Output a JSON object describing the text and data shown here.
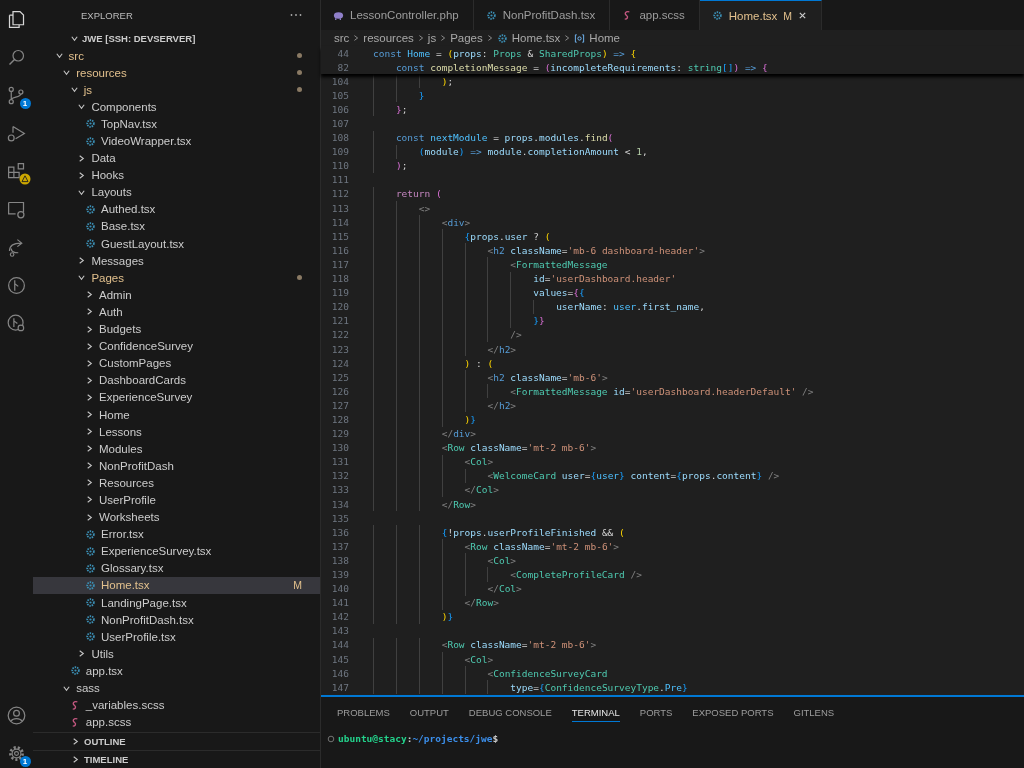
{
  "activity_bar": {
    "top": [
      {
        "kind": "explorer",
        "selected": true
      },
      {
        "kind": "search",
        "selected": false
      },
      {
        "kind": "scm",
        "selected": false,
        "badge": "1"
      },
      {
        "kind": "debug",
        "selected": false
      },
      {
        "kind": "extensions",
        "selected": false,
        "warning": true
      },
      {
        "kind": "remote",
        "selected": false
      },
      {
        "kind": "share",
        "selected": false
      },
      {
        "kind": "graph",
        "selected": false
      },
      {
        "kind": "history",
        "selected": false
      }
    ],
    "bottom": [
      {
        "kind": "account",
        "selected": false
      },
      {
        "kind": "settings",
        "selected": false,
        "badge": "1"
      }
    ]
  },
  "explorer": {
    "title": "EXPLORER",
    "project": {
      "label": "JWE [SSH: DEVSERVER]",
      "expanded": true
    },
    "tree": [
      {
        "label": "src",
        "kind": "folder",
        "expanded": true,
        "modified": true,
        "selected": false,
        "children": [
          {
            "label": "resources",
            "kind": "folder",
            "expanded": true,
            "modified": true,
            "selected": false,
            "children": [
              {
                "label": "js",
                "kind": "folder",
                "expanded": true,
                "modified": true,
                "selected": false,
                "children": [
                  {
                    "label": "Components",
                    "kind": "folder",
                    "expanded": true,
                    "modified": false,
                    "selected": false,
                    "children": [
                      {
                        "label": "TopNav.tsx",
                        "kind": "react",
                        "modified": false,
                        "selected": false
                      },
                      {
                        "label": "VideoWrapper.tsx",
                        "kind": "react",
                        "modified": false,
                        "selected": false
                      }
                    ]
                  },
                  {
                    "label": "Data",
                    "kind": "folder",
                    "expanded": false,
                    "modified": false,
                    "selected": false
                  },
                  {
                    "label": "Hooks",
                    "kind": "folder",
                    "expanded": false,
                    "modified": false,
                    "selected": false
                  },
                  {
                    "label": "Layouts",
                    "kind": "folder",
                    "expanded": true,
                    "modified": false,
                    "selected": false,
                    "children": [
                      {
                        "label": "Authed.tsx",
                        "kind": "react",
                        "modified": false,
                        "selected": false
                      },
                      {
                        "label": "Base.tsx",
                        "kind": "react",
                        "modified": false,
                        "selected": false
                      },
                      {
                        "label": "GuestLayout.tsx",
                        "kind": "react",
                        "modified": false,
                        "selected": false
                      }
                    ]
                  },
                  {
                    "label": "Messages",
                    "kind": "folder",
                    "expanded": false,
                    "modified": false,
                    "selected": false
                  },
                  {
                    "label": "Pages",
                    "kind": "folder",
                    "expanded": true,
                    "modified": true,
                    "selected": false,
                    "children": [
                      {
                        "label": "Admin",
                        "kind": "folder",
                        "expanded": false,
                        "modified": false,
                        "selected": false
                      },
                      {
                        "label": "Auth",
                        "kind": "folder",
                        "expanded": false,
                        "modified": false,
                        "selected": false
                      },
                      {
                        "label": "Budgets",
                        "kind": "folder",
                        "expanded": false,
                        "modified": false,
                        "selected": false
                      },
                      {
                        "label": "ConfidenceSurvey",
                        "kind": "folder",
                        "expanded": false,
                        "modified": false,
                        "selected": false
                      },
                      {
                        "label": "CustomPages",
                        "kind": "folder",
                        "expanded": false,
                        "modified": false,
                        "selected": false
                      },
                      {
                        "label": "DashboardCards",
                        "kind": "folder",
                        "expanded": false,
                        "modified": false,
                        "selected": false
                      },
                      {
                        "label": "ExperienceSurvey",
                        "kind": "folder",
                        "expanded": false,
                        "modified": false,
                        "selected": false
                      },
                      {
                        "label": "Home",
                        "kind": "folder",
                        "expanded": false,
                        "modified": false,
                        "selected": false
                      },
                      {
                        "label": "Lessons",
                        "kind": "folder",
                        "expanded": false,
                        "modified": false,
                        "selected": false
                      },
                      {
                        "label": "Modules",
                        "kind": "folder",
                        "expanded": false,
                        "modified": false,
                        "selected": false
                      },
                      {
                        "label": "NonProfitDash",
                        "kind": "folder",
                        "expanded": false,
                        "modified": false,
                        "selected": false
                      },
                      {
                        "label": "Resources",
                        "kind": "folder",
                        "expanded": false,
                        "modified": false,
                        "selected": false
                      },
                      {
                        "label": "UserProfile",
                        "kind": "folder",
                        "expanded": false,
                        "modified": false,
                        "selected": false
                      },
                      {
                        "label": "Worksheets",
                        "kind": "folder",
                        "expanded": false,
                        "modified": false,
                        "selected": false
                      },
                      {
                        "label": "Error.tsx",
                        "kind": "react",
                        "modified": false,
                        "selected": false
                      },
                      {
                        "label": "ExperienceSurvey.tsx",
                        "kind": "react",
                        "modified": false,
                        "selected": false
                      },
                      {
                        "label": "Glossary.tsx",
                        "kind": "react",
                        "modified": false,
                        "selected": false
                      },
                      {
                        "label": "Home.tsx",
                        "kind": "react",
                        "modified": true,
                        "selected": true,
                        "badge": "M"
                      },
                      {
                        "label": "LandingPage.tsx",
                        "kind": "react",
                        "modified": false,
                        "selected": false
                      },
                      {
                        "label": "NonProfitDash.tsx",
                        "kind": "react",
                        "modified": false,
                        "selected": false
                      },
                      {
                        "label": "UserProfile.tsx",
                        "kind": "react",
                        "modified": false,
                        "selected": false
                      }
                    ]
                  },
                  {
                    "label": "Utils",
                    "kind": "folder",
                    "expanded": false,
                    "modified": false,
                    "selected": false
                  }
                ]
              },
              {
                "label": "app.tsx",
                "kind": "react",
                "modified": false,
                "selected": false
              }
            ]
          },
          {
            "label": "sass",
            "kind": "folder",
            "expanded": true,
            "modified": false,
            "selected": false,
            "children": [
              {
                "label": "_variables.scss",
                "kind": "sass",
                "modified": false,
                "selected": false
              },
              {
                "label": "app.scss",
                "kind": "sass",
                "modified": false,
                "selected": false
              }
            ]
          }
        ]
      }
    ],
    "sections": [
      {
        "label": "OUTLINE",
        "expanded": false
      },
      {
        "label": "TIMELINE",
        "expanded": false
      }
    ]
  },
  "editor": {
    "tabs": [
      {
        "label": "LessonController.php",
        "kind": "php",
        "selected": false,
        "modified": false
      },
      {
        "label": "NonProfitDash.tsx",
        "kind": "react",
        "selected": false,
        "modified": false
      },
      {
        "label": "app.scss",
        "kind": "sass",
        "selected": false,
        "modified": false
      },
      {
        "label": "Home.tsx",
        "kind": "react",
        "selected": true,
        "modified": true,
        "badge": "M"
      }
    ],
    "breadcrumbs": [
      {
        "label": "src",
        "kind": "folder"
      },
      {
        "label": "resources",
        "kind": "folder"
      },
      {
        "label": "js",
        "kind": "folder"
      },
      {
        "label": "Pages",
        "kind": "folder"
      },
      {
        "label": "Home.tsx",
        "kind": "react"
      },
      {
        "label": "Home",
        "kind": "symbol"
      }
    ],
    "sticky_lines": [
      {
        "number": "44",
        "tokens": [
          {
            "text": "const ",
            "kind": "keyword"
          },
          {
            "text": "Home",
            "kind": "constant"
          },
          {
            "text": " = ",
            "kind": "plain"
          },
          {
            "text": "(",
            "kind": "bracket1"
          },
          {
            "text": "props",
            "kind": "variable"
          },
          {
            "text": ": ",
            "kind": "plain"
          },
          {
            "text": "Props",
            "kind": "type"
          },
          {
            "text": " & ",
            "kind": "plain"
          },
          {
            "text": "SharedProps",
            "kind": "type"
          },
          {
            "text": ")",
            "kind": "bracket1"
          },
          {
            "text": " => ",
            "kind": "keyword"
          },
          {
            "text": "{",
            "kind": "bracket1"
          }
        ]
      },
      {
        "number": "82",
        "tokens": [
          {
            "text": "    const ",
            "kind": "keyword"
          },
          {
            "text": "completionMessage",
            "kind": "function"
          },
          {
            "text": " = ",
            "kind": "plain"
          },
          {
            "text": "(",
            "kind": "bracket2"
          },
          {
            "text": "incompleteRequirements",
            "kind": "variable"
          },
          {
            "text": ": ",
            "kind": "plain"
          },
          {
            "text": "string",
            "kind": "type"
          },
          {
            "text": "[]",
            "kind": "bracket3"
          },
          {
            "text": ")",
            "kind": "bracket2"
          },
          {
            "text": " => ",
            "kind": "keyword"
          },
          {
            "text": "{",
            "kind": "bracket2"
          }
        ]
      }
    ],
    "lines": [
      {
        "number": "104",
        "tokens": [
          {
            "text": "            )",
            "kind": "bracket1"
          },
          {
            "text": ";",
            "kind": "plain"
          }
        ]
      },
      {
        "number": "105",
        "tokens": [
          {
            "text": "        }",
            "kind": "bracket3"
          }
        ]
      },
      {
        "number": "106",
        "tokens": [
          {
            "text": "    }",
            "kind": "bracket2"
          },
          {
            "text": ";",
            "kind": "plain"
          }
        ]
      },
      {
        "number": "107"
      },
      {
        "number": "108",
        "tokens": [
          {
            "text": "    const ",
            "kind": "keyword"
          },
          {
            "text": "nextModule",
            "kind": "constant"
          },
          {
            "text": " = ",
            "kind": "plain"
          },
          {
            "text": "props",
            "kind": "variable"
          },
          {
            "text": ".",
            "kind": "plain"
          },
          {
            "text": "modules",
            "kind": "variable"
          },
          {
            "text": ".",
            "kind": "plain"
          },
          {
            "text": "find",
            "kind": "function"
          },
          {
            "text": "(",
            "kind": "bracket2"
          }
        ]
      },
      {
        "number": "109",
        "tokens": [
          {
            "text": "        (",
            "kind": "bracket3"
          },
          {
            "text": "module",
            "kind": "variable"
          },
          {
            "text": ")",
            "kind": "bracket3"
          },
          {
            "text": " => ",
            "kind": "keyword"
          },
          {
            "text": "module",
            "kind": "variable"
          },
          {
            "text": ".",
            "kind": "plain"
          },
          {
            "text": "completionAmount",
            "kind": "variable"
          },
          {
            "text": " < ",
            "kind": "plain"
          },
          {
            "text": "1",
            "kind": "number"
          },
          {
            "text": ",",
            "kind": "plain"
          }
        ]
      },
      {
        "number": "110",
        "tokens": [
          {
            "text": "    )",
            "kind": "bracket2"
          },
          {
            "text": ";",
            "kind": "plain"
          }
        ]
      },
      {
        "number": "111"
      },
      {
        "number": "112",
        "tokens": [
          {
            "text": "    return ",
            "kind": "control"
          },
          {
            "text": "(",
            "kind": "bracket2"
          }
        ]
      },
      {
        "number": "113",
        "tokens": [
          {
            "text": "        <>",
            "kind": "tag"
          }
        ]
      },
      {
        "number": "114",
        "tokens": [
          {
            "text": "            <",
            "kind": "tag"
          },
          {
            "text": "div",
            "kind": "html"
          },
          {
            "text": ">",
            "kind": "tag"
          }
        ]
      },
      {
        "number": "115",
        "tokens": [
          {
            "text": "                {",
            "kind": "bracket3"
          },
          {
            "text": "props",
            "kind": "variable"
          },
          {
            "text": ".",
            "kind": "plain"
          },
          {
            "text": "user",
            "kind": "variable"
          },
          {
            "text": " ? ",
            "kind": "plain"
          },
          {
            "text": "(",
            "kind": "bracket1"
          }
        ]
      },
      {
        "number": "116",
        "tokens": [
          {
            "text": "                    <",
            "kind": "tag"
          },
          {
            "text": "h2",
            "kind": "html"
          },
          {
            "text": " className",
            "kind": "variable"
          },
          {
            "text": "=",
            "kind": "plain"
          },
          {
            "text": "'mb-6 dashboard-header'",
            "kind": "string"
          },
          {
            "text": ">",
            "kind": "tag"
          }
        ]
      },
      {
        "number": "117",
        "tokens": [
          {
            "text": "                        <",
            "kind": "tag"
          },
          {
            "text": "FormattedMessage",
            "kind": "type"
          }
        ]
      },
      {
        "number": "118",
        "tokens": [
          {
            "text": "                            id",
            "kind": "variable"
          },
          {
            "text": "=",
            "kind": "plain"
          },
          {
            "text": "'userDashboard.header'",
            "kind": "string"
          }
        ]
      },
      {
        "number": "119",
        "tokens": [
          {
            "text": "                            values",
            "kind": "variable"
          },
          {
            "text": "=",
            "kind": "plain"
          },
          {
            "text": "{",
            "kind": "bracket2"
          },
          {
            "text": "{",
            "kind": "bracket3"
          }
        ]
      },
      {
        "number": "120",
        "tokens": [
          {
            "text": "                                userName",
            "kind": "variable"
          },
          {
            "text": ": ",
            "kind": "plain"
          },
          {
            "text": "user",
            "kind": "constant"
          },
          {
            "text": ".",
            "kind": "plain"
          },
          {
            "text": "first_name",
            "kind": "variable"
          },
          {
            "text": ",",
            "kind": "plain"
          }
        ]
      },
      {
        "number": "121",
        "tokens": [
          {
            "text": "                            }",
            "kind": "bracket3"
          },
          {
            "text": "}",
            "kind": "bracket2"
          }
        ]
      },
      {
        "number": "122",
        "tokens": [
          {
            "text": "                        />",
            "kind": "tag"
          }
        ]
      },
      {
        "number": "123",
        "tokens": [
          {
            "text": "                    </",
            "kind": "tag"
          },
          {
            "text": "h2",
            "kind": "html"
          },
          {
            "text": ">",
            "kind": "tag"
          }
        ]
      },
      {
        "number": "124",
        "tokens": [
          {
            "text": "                )",
            "kind": "bracket1"
          },
          {
            "text": " : ",
            "kind": "plain"
          },
          {
            "text": "(",
            "kind": "bracket1"
          }
        ]
      },
      {
        "number": "125",
        "tokens": [
          {
            "text": "                    <",
            "kind": "tag"
          },
          {
            "text": "h2",
            "kind": "html"
          },
          {
            "text": " className",
            "kind": "variable"
          },
          {
            "text": "=",
            "kind": "plain"
          },
          {
            "text": "'mb-6'",
            "kind": "string"
          },
          {
            "text": ">",
            "kind": "tag"
          }
        ]
      },
      {
        "number": "126",
        "tokens": [
          {
            "text": "                        <",
            "kind": "tag"
          },
          {
            "text": "FormattedMessage",
            "kind": "type"
          },
          {
            "text": " id",
            "kind": "variable"
          },
          {
            "text": "=",
            "kind": "plain"
          },
          {
            "text": "'userDashboard.headerDefault'",
            "kind": "string"
          },
          {
            "text": " />",
            "kind": "tag"
          }
        ]
      },
      {
        "number": "127",
        "tokens": [
          {
            "text": "                    </",
            "kind": "tag"
          },
          {
            "text": "h2",
            "kind": "html"
          },
          {
            "text": ">",
            "kind": "tag"
          }
        ]
      },
      {
        "number": "128",
        "tokens": [
          {
            "text": "                )",
            "kind": "bracket1"
          },
          {
            "text": "}",
            "kind": "bracket3"
          }
        ]
      },
      {
        "number": "129",
        "tokens": [
          {
            "text": "            </",
            "kind": "tag"
          },
          {
            "text": "div",
            "kind": "html"
          },
          {
            "text": ">",
            "kind": "tag"
          }
        ]
      },
      {
        "number": "130",
        "tokens": [
          {
            "text": "            <",
            "kind": "tag"
          },
          {
            "text": "Row",
            "kind": "type"
          },
          {
            "text": " className",
            "kind": "variable"
          },
          {
            "text": "=",
            "kind": "plain"
          },
          {
            "text": "'mt-2 mb-6'",
            "kind": "string"
          },
          {
            "text": ">",
            "kind": "tag"
          }
        ]
      },
      {
        "number": "131",
        "tokens": [
          {
            "text": "                <",
            "kind": "tag"
          },
          {
            "text": "Col",
            "kind": "type"
          },
          {
            "text": ">",
            "kind": "tag"
          }
        ]
      },
      {
        "number": "132",
        "tokens": [
          {
            "text": "                    <",
            "kind": "tag"
          },
          {
            "text": "WelcomeCard",
            "kind": "type"
          },
          {
            "text": " user",
            "kind": "variable"
          },
          {
            "text": "=",
            "kind": "plain"
          },
          {
            "text": "{",
            "kind": "bracket3"
          },
          {
            "text": "user",
            "kind": "constant"
          },
          {
            "text": "}",
            "kind": "bracket3"
          },
          {
            "text": " content",
            "kind": "variable"
          },
          {
            "text": "=",
            "kind": "plain"
          },
          {
            "text": "{",
            "kind": "bracket3"
          },
          {
            "text": "props",
            "kind": "variable"
          },
          {
            "text": ".",
            "kind": "plain"
          },
          {
            "text": "content",
            "kind": "variable"
          },
          {
            "text": "}",
            "kind": "bracket3"
          },
          {
            "text": " />",
            "kind": "tag"
          }
        ]
      },
      {
        "number": "133",
        "tokens": [
          {
            "text": "                </",
            "kind": "tag"
          },
          {
            "text": "Col",
            "kind": "type"
          },
          {
            "text": ">",
            "kind": "tag"
          }
        ]
      },
      {
        "number": "134",
        "tokens": [
          {
            "text": "            </",
            "kind": "tag"
          },
          {
            "text": "Row",
            "kind": "type"
          },
          {
            "text": ">",
            "kind": "tag"
          }
        ]
      },
      {
        "number": "135"
      },
      {
        "number": "136",
        "tokens": [
          {
            "text": "            {",
            "kind": "bracket3"
          },
          {
            "text": "!",
            "kind": "plain"
          },
          {
            "text": "props",
            "kind": "variable"
          },
          {
            "text": ".",
            "kind": "plain"
          },
          {
            "text": "userProfileFinished",
            "kind": "variable"
          },
          {
            "text": " && ",
            "kind": "plain"
          },
          {
            "text": "(",
            "kind": "bracket1"
          }
        ]
      },
      {
        "number": "137",
        "tokens": [
          {
            "text": "                <",
            "kind": "tag"
          },
          {
            "text": "Row",
            "kind": "type"
          },
          {
            "text": " className",
            "kind": "variable"
          },
          {
            "text": "=",
            "kind": "plain"
          },
          {
            "text": "'mt-2 mb-6'",
            "kind": "string"
          },
          {
            "text": ">",
            "kind": "tag"
          }
        ]
      },
      {
        "number": "138",
        "tokens": [
          {
            "text": "                    <",
            "kind": "tag"
          },
          {
            "text": "Col",
            "kind": "type"
          },
          {
            "text": ">",
            "kind": "tag"
          }
        ]
      },
      {
        "number": "139",
        "tokens": [
          {
            "text": "                        <",
            "kind": "tag"
          },
          {
            "text": "CompleteProfileCard",
            "kind": "type"
          },
          {
            "text": " />",
            "kind": "tag"
          }
        ]
      },
      {
        "number": "140",
        "tokens": [
          {
            "text": "                    </",
            "kind": "tag"
          },
          {
            "text": "Col",
            "kind": "type"
          },
          {
            "text": ">",
            "kind": "tag"
          }
        ]
      },
      {
        "number": "141",
        "tokens": [
          {
            "text": "                </",
            "kind": "tag"
          },
          {
            "text": "Row",
            "kind": "type"
          },
          {
            "text": ">",
            "kind": "tag"
          }
        ]
      },
      {
        "number": "142",
        "tokens": [
          {
            "text": "            )",
            "kind": "bracket1"
          },
          {
            "text": "}",
            "kind": "bracket3"
          }
        ]
      },
      {
        "number": "143"
      },
      {
        "number": "144",
        "tokens": [
          {
            "text": "            <",
            "kind": "tag"
          },
          {
            "text": "Row",
            "kind": "type"
          },
          {
            "text": " className",
            "kind": "variable"
          },
          {
            "text": "=",
            "kind": "plain"
          },
          {
            "text": "'mt-2 mb-6'",
            "kind": "string"
          },
          {
            "text": ">",
            "kind": "tag"
          }
        ]
      },
      {
        "number": "145",
        "tokens": [
          {
            "text": "                <",
            "kind": "tag"
          },
          {
            "text": "Col",
            "kind": "type"
          },
          {
            "text": ">",
            "kind": "tag"
          }
        ]
      },
      {
        "number": "146",
        "tokens": [
          {
            "text": "                    <",
            "kind": "tag"
          },
          {
            "text": "ConfidenceSurveyCard",
            "kind": "type"
          }
        ]
      },
      {
        "number": "147",
        "tokens": [
          {
            "text": "                        type",
            "kind": "variable"
          },
          {
            "text": "=",
            "kind": "plain"
          },
          {
            "text": "{",
            "kind": "bracket3"
          },
          {
            "text": "ConfidenceSurveyType",
            "kind": "type"
          },
          {
            "text": ".",
            "kind": "plain"
          },
          {
            "text": "Pre",
            "kind": "constant"
          },
          {
            "text": "}",
            "kind": "bracket3"
          }
        ]
      }
    ]
  },
  "panel": {
    "tabs": [
      {
        "label": "PROBLEMS",
        "selected": false
      },
      {
        "label": "OUTPUT",
        "selected": false
      },
      {
        "label": "DEBUG CONSOLE",
        "selected": false
      },
      {
        "label": "TERMINAL",
        "selected": true
      },
      {
        "label": "PORTS",
        "selected": false
      },
      {
        "label": "EXPOSED PORTS",
        "selected": false
      },
      {
        "label": "GITLENS",
        "selected": false
      }
    ],
    "terminal": {
      "prompt": [
        {
          "text": "ubuntu@stacy",
          "kind": "user"
        },
        {
          "text": ":",
          "kind": "plain"
        },
        {
          "text": "~/projects/jwe",
          "kind": "path"
        },
        {
          "text": "$",
          "kind": "plain"
        }
      ]
    }
  }
}
